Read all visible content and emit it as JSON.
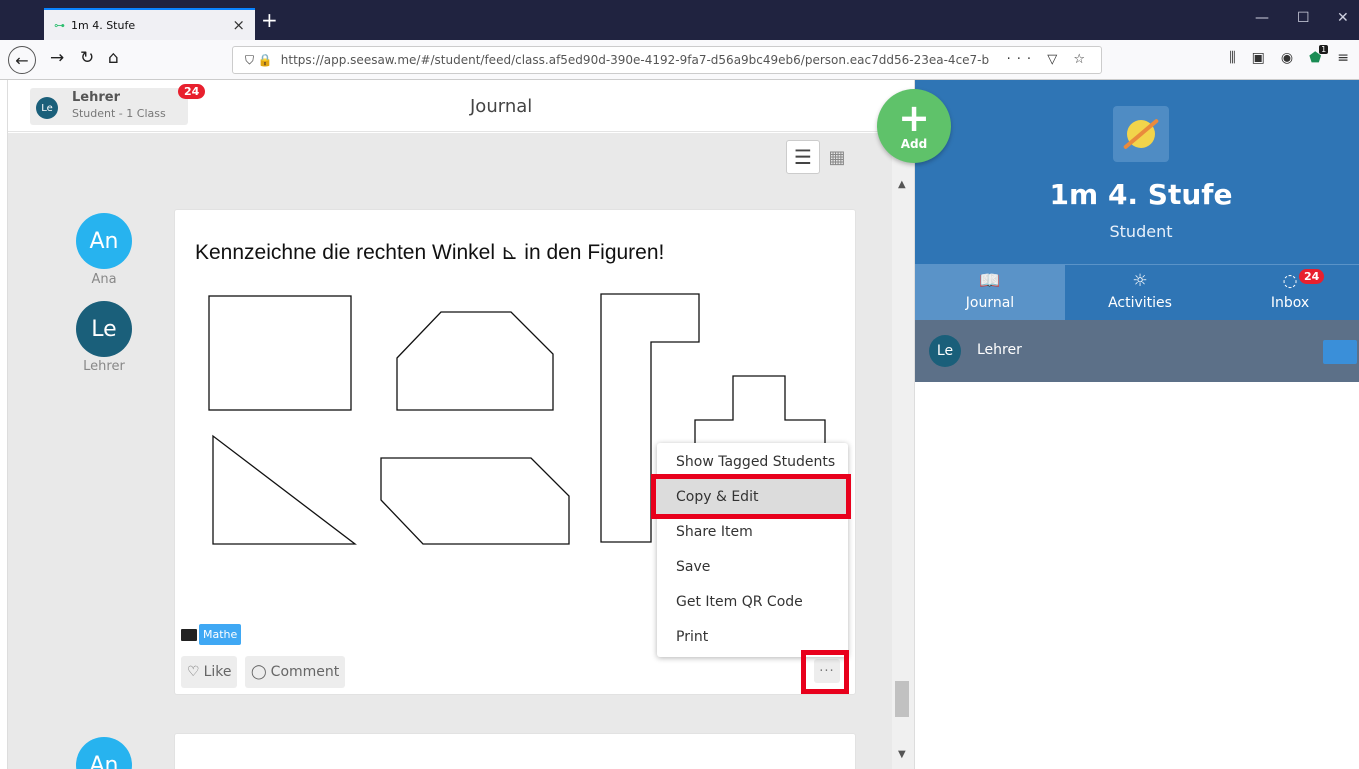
{
  "browser": {
    "tab_title": "1m 4. Stufe",
    "tab_close": "×",
    "new_tab": "+",
    "url": "https://app.seesaw.me/#/student/feed/class.af5ed90d-390e-4192-9fa7-d56a9bc49eb6/person.eac7dd56-23ea-4ce7-b",
    "url_right_icons": "··· ▽ ☆",
    "window_controls": [
      "—",
      "☐",
      "✕"
    ],
    "extension_badge": "1"
  },
  "header": {
    "profile_initials": "Le",
    "profile_name": "Lehrer",
    "profile_sub": "Student - 1 Class",
    "notification_count": "24",
    "title": "Journal"
  },
  "add_button": {
    "icon": "+",
    "label": "Add"
  },
  "students": [
    {
      "initials": "An",
      "name": "Ana",
      "color": "#27b3ef"
    },
    {
      "initials": "Le",
      "name": "Lehrer",
      "color": "#1a5f7a"
    }
  ],
  "post": {
    "prompt": "Kennzeichne die rechten Winkel ⊾ in den Figuren!",
    "tag": "Mathe",
    "like_label": "Like",
    "comment_label": "Comment",
    "more_label": "···"
  },
  "next_post_initials": "An",
  "menu": {
    "items": [
      "Show Tagged Students",
      "Copy & Edit",
      "Share Item",
      "Save",
      "Get Item QR Code",
      "Print"
    ],
    "active_index": 1
  },
  "right_panel": {
    "class_name": "1m 4. Stufe",
    "role": "Student",
    "tabs": [
      {
        "label": "Journal",
        "icon": "book-icon"
      },
      {
        "label": "Activities",
        "icon": "lightbulb-icon"
      },
      {
        "label": "Inbox",
        "icon": "chat-icon",
        "badge": "24"
      }
    ],
    "row": {
      "initials": "Le",
      "name": "Lehrer"
    }
  },
  "colors": {
    "accent_blue": "#2f75b5",
    "add_green": "#5fc26a",
    "badge_red": "#e8202e",
    "highlight_red": "#e8001c",
    "tag_blue": "#3fa8f4"
  }
}
